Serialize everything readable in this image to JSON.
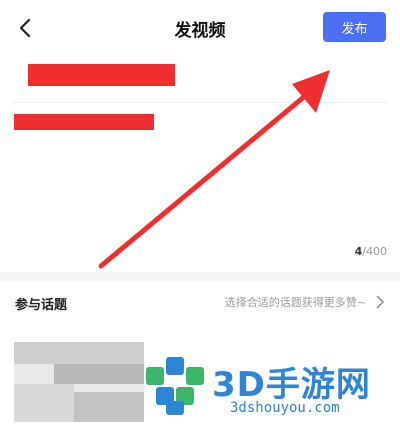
{
  "header": {
    "title": "发视频",
    "publish_label": "发布"
  },
  "editor": {
    "char_count": "4",
    "char_limit": "/400"
  },
  "topics": {
    "label": "参与话题",
    "hint": "选择合适的话题获得更多赞~"
  },
  "watermark": {
    "brand": "3D手游网",
    "url": "3dshouyou.com"
  },
  "colors": {
    "accent": "#4a6ff2",
    "annotation_red": "#ef2f2f",
    "watermark_blue": "#2d85d6"
  }
}
